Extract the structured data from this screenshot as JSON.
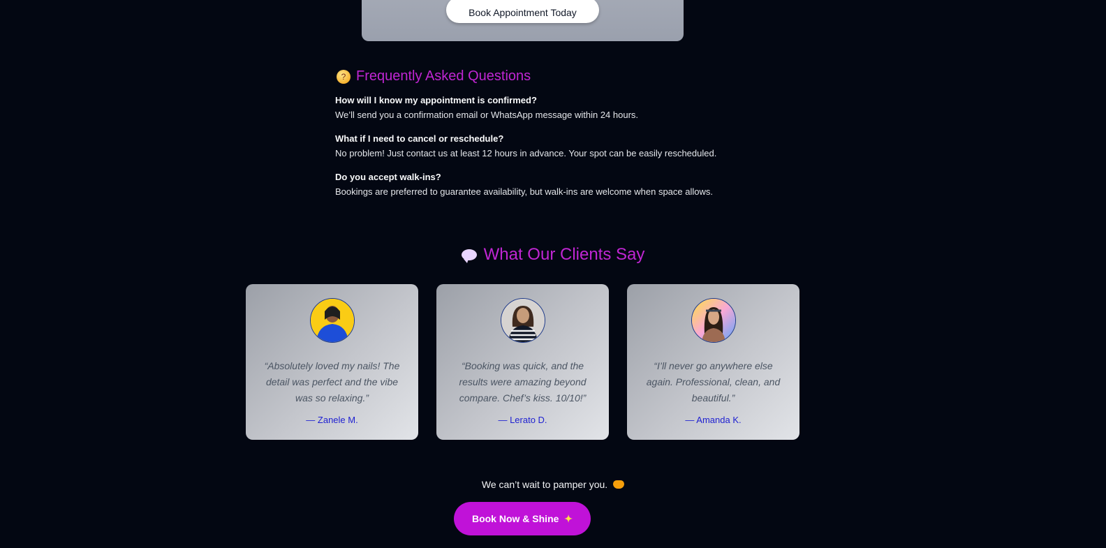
{
  "booking": {
    "button_label": "Book Appointment Today"
  },
  "faq": {
    "heading": "Frequently Asked Questions",
    "icon": "thinking-face-icon",
    "items": [
      {
        "question": "How will I know my appointment is confirmed?",
        "answer": "We’ll send you a confirmation email or WhatsApp message within 24 hours."
      },
      {
        "question": "What if I need to cancel or reschedule?",
        "answer": "No problem! Just contact us at least 12 hours in advance. Your spot can be easily rescheduled."
      },
      {
        "question": "Do you accept walk-ins?",
        "answer": "Bookings are preferred to guarantee availability, but walk-ins are welcome when space allows."
      }
    ]
  },
  "testimonials": {
    "heading": "What Our Clients Say",
    "icon": "speech-bubble-icon",
    "items": [
      {
        "quote": "“Absolutely loved my nails! The detail was perfect and the vibe was so relaxing.”",
        "author": "— Zanele M.",
        "avatar_bg": "#facc15"
      },
      {
        "quote": "“Booking was quick, and the results were amazing beyond compare. Chef’s kiss. 10/10!”",
        "author": "— Lerato D.",
        "avatar_bg": "#d6d3d1"
      },
      {
        "quote": "“I’ll never go anywhere else again. Professional, clean, and beautiful.”",
        "author": "— Amanda K.",
        "avatar_bg": "#f9a8d4"
      }
    ]
  },
  "cta": {
    "tagline": "We can’t wait to pamper you.",
    "tagline_icon": "heart-hands-icon",
    "button_label": "Book Now & Shine",
    "button_icon": "sparkles-icon"
  },
  "colors": {
    "background": "#030712",
    "accent": "#c026d3",
    "author_link": "#1d1fd1"
  }
}
